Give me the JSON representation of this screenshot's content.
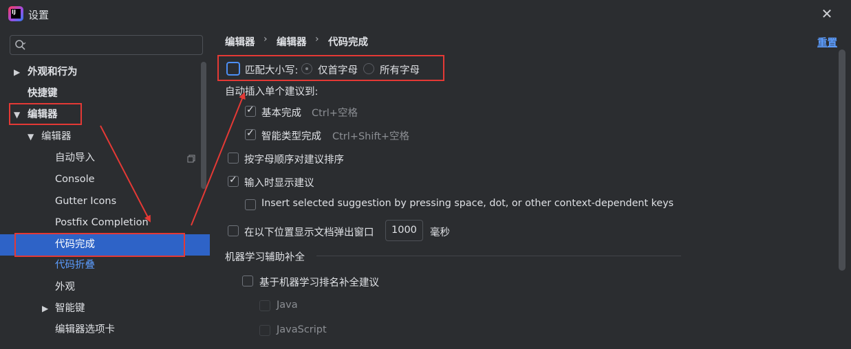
{
  "window": {
    "title": "设置",
    "close_icon": "close-icon"
  },
  "search": {
    "placeholder": "",
    "icon": "search-icon"
  },
  "sidebar": {
    "items": [
      {
        "label": "外观和行为"
      },
      {
        "label": "快捷键"
      },
      {
        "label": "编辑器"
      },
      {
        "label": "编辑器"
      },
      {
        "label": "自动导入"
      },
      {
        "label": "Console"
      },
      {
        "label": "Gutter Icons"
      },
      {
        "label": "Postfix Completion"
      },
      {
        "label": "代码完成"
      },
      {
        "label": "代码折叠"
      },
      {
        "label": "外观"
      },
      {
        "label": "智能键"
      },
      {
        "label": "编辑器选项卡"
      }
    ]
  },
  "breadcrumb": {
    "items": [
      "编辑器",
      "编辑器",
      "代码完成"
    ],
    "separator": "›"
  },
  "reset_label": "重置",
  "settings": {
    "match_case": {
      "label": "匹配大小写:",
      "checked": false
    },
    "radio_first": {
      "label": "仅首字母",
      "selected": true
    },
    "radio_all": {
      "label": "所有字母",
      "selected": false
    },
    "auto_insert_label": "自动插入单个建议到:",
    "basic_completion": {
      "label": "基本完成",
      "shortcut": "Ctrl+空格",
      "checked": true
    },
    "smart_completion": {
      "label": "智能类型完成",
      "shortcut": "Ctrl+Shift+空格",
      "checked": true
    },
    "sort_alpha": {
      "label": "按字母顺序对建议排序",
      "checked": false
    },
    "show_while_typing": {
      "label": "输入时显示建议",
      "checked": true
    },
    "insert_selected": {
      "label": "Insert selected suggestion by pressing space, dot, or other context-dependent keys",
      "checked": false
    },
    "doc_popup": {
      "label": "在以下位置显示文档弹出窗口",
      "value": "1000",
      "unit": "毫秒",
      "checked": false
    },
    "ml_section_title": "机器学习辅助补全",
    "ml_rank": {
      "label": "基于机器学习排名补全建议",
      "checked": false
    },
    "ml_java": {
      "label": "Java",
      "checked": false
    },
    "ml_javascript": {
      "label": "JavaScript",
      "checked": false
    }
  },
  "colors": {
    "accent": "#2e63c7",
    "link": "#5c9dff",
    "annotation": "#e53935"
  }
}
